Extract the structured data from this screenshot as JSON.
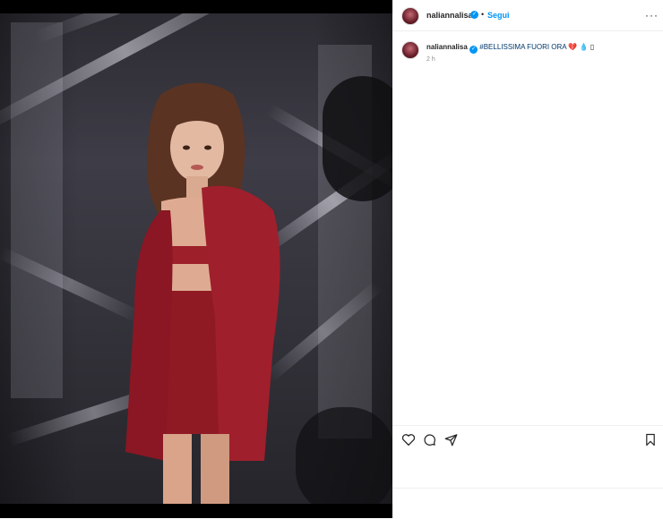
{
  "post": {
    "username": "nalianna lisa",
    "username_display": "naliannalisa",
    "follow_label": "Segui",
    "dot": "•",
    "more_label": "···",
    "caption_user": "naliannalisa",
    "caption_hashtag": "#BELLISSIMA FUORI ORA",
    "caption_emojis": "💔 💧 ▯",
    "time_ago": "2 h"
  },
  "colors": {
    "accent": "#0095f6",
    "text": "#262626",
    "muted": "#8e8e8e",
    "jacket": "#8f1a24"
  },
  "icons": [
    "heart-icon",
    "comment-icon",
    "share-icon",
    "bookmark-icon",
    "verified-icon",
    "more-icon"
  ]
}
